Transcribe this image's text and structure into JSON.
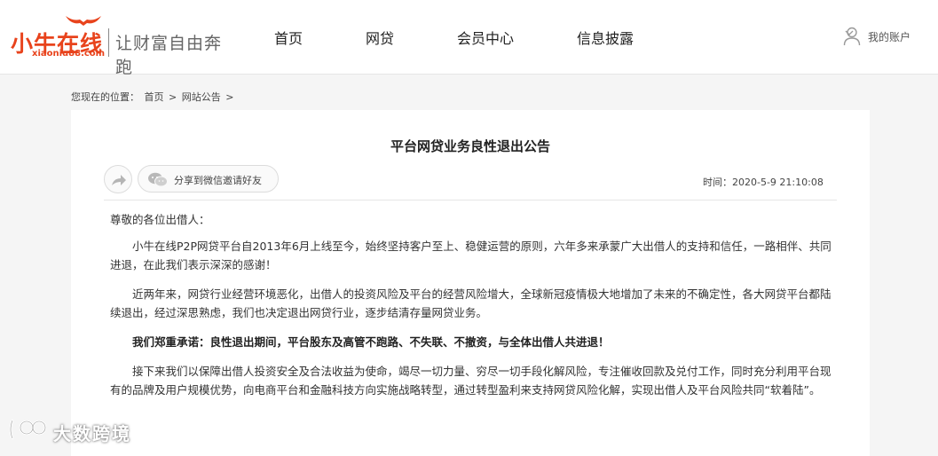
{
  "header": {
    "logo": {
      "name": "小牛在线",
      "domain": "xiaoniu88.com",
      "slogan": "让财富自由奔跑",
      "brand_color": "#e8431c"
    },
    "nav": [
      {
        "label": "首页"
      },
      {
        "label": "网贷"
      },
      {
        "label": "会员中心"
      },
      {
        "label": "信息披露"
      }
    ],
    "account": {
      "label": "我的账户",
      "icon": "user-icon"
    }
  },
  "breadcrumb": {
    "prefix": "您现在的位置：",
    "items": [
      "首页",
      "网站公告"
    ],
    "separator": ">"
  },
  "article": {
    "title": "平台网贷业务良性退出公告",
    "share_icon": "share-arrow-icon",
    "wechat_share_label": "分享到微信邀请好友",
    "wechat_icon": "wechat-icon",
    "time": "时间：2020-5-9 21:10:08",
    "greeting": "尊敬的各位出借人：",
    "paragraphs": [
      "小牛在线P2P网贷平台自2013年6月上线至今，始终坚持客户至上、稳健运营的原则，六年多来承蒙广大出借人的支持和信任，一路相伴、共同进退，在此我们表示深深的感谢！",
      "近两年来，网贷行业经营环境恶化，出借人的投资风险及平台的经营风险增大，全球新冠疫情极大地增加了未来的不确定性，各大网贷平台都陆续退出，经过深思熟虑，我们也决定退出网贷行业，逐步结清存量网贷业务。",
      "我们郑重承诺：良性退出期间，平台股东及高管不跑路、不失联、不撤资，与全体出借人共进退！",
      "接下来我们以保障出借人投资安全及合法收益为使命，竭尽一切力量、穷尽一切手段化解风险，专注催收回款及兑付工作，同时充分利用平台现有的品牌及用户规模优势，向电商平台和金融科技方向实施战略转型，通过转型盈利来支持网贷风险化解，实现出借人及平台风险共同“软着陆”。"
    ]
  },
  "watermark": {
    "text": "大数跨境",
    "icon": "watermark-logo-icon"
  }
}
